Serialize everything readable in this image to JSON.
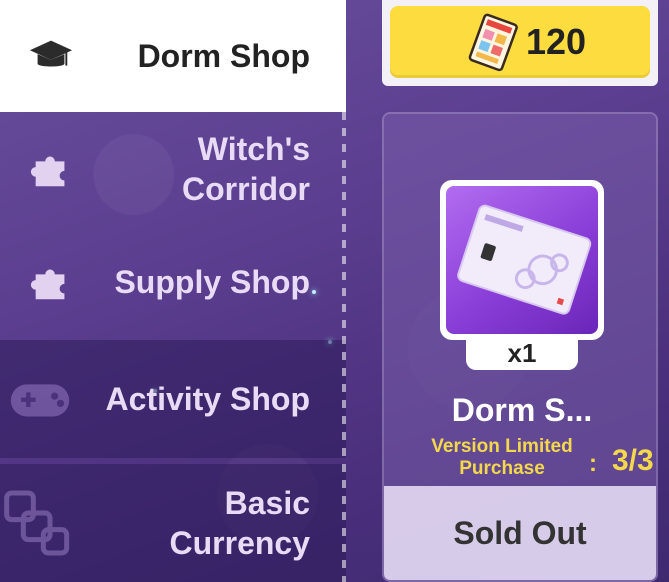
{
  "sidebar": {
    "items": [
      {
        "label": "Dorm Shop",
        "icon": "graduation-cap-icon",
        "active": true
      },
      {
        "label": "Witch's Corridor",
        "icon": "puzzle-piece-icon",
        "active": false
      },
      {
        "label": "Supply Shop",
        "icon": "puzzle-piece-icon",
        "active": false
      },
      {
        "label": "Activity Shop",
        "icon": "gamepad-icon",
        "active": false
      },
      {
        "label": "Basic Currency",
        "icon": "cubes-icon",
        "active": false
      }
    ]
  },
  "currency": {
    "amount": "120",
    "icon": "ticket-icon"
  },
  "item": {
    "quantity": "x1",
    "name": "Dorm S...",
    "limit_label": "Version Limited Purchase",
    "limit_colon": ":",
    "limit_count": "3/3",
    "status": "Sold Out"
  },
  "colors": {
    "accent_yellow": "#fddc3f",
    "bg_purple": "#5b3e8f",
    "limit_text": "#f2d84a"
  }
}
